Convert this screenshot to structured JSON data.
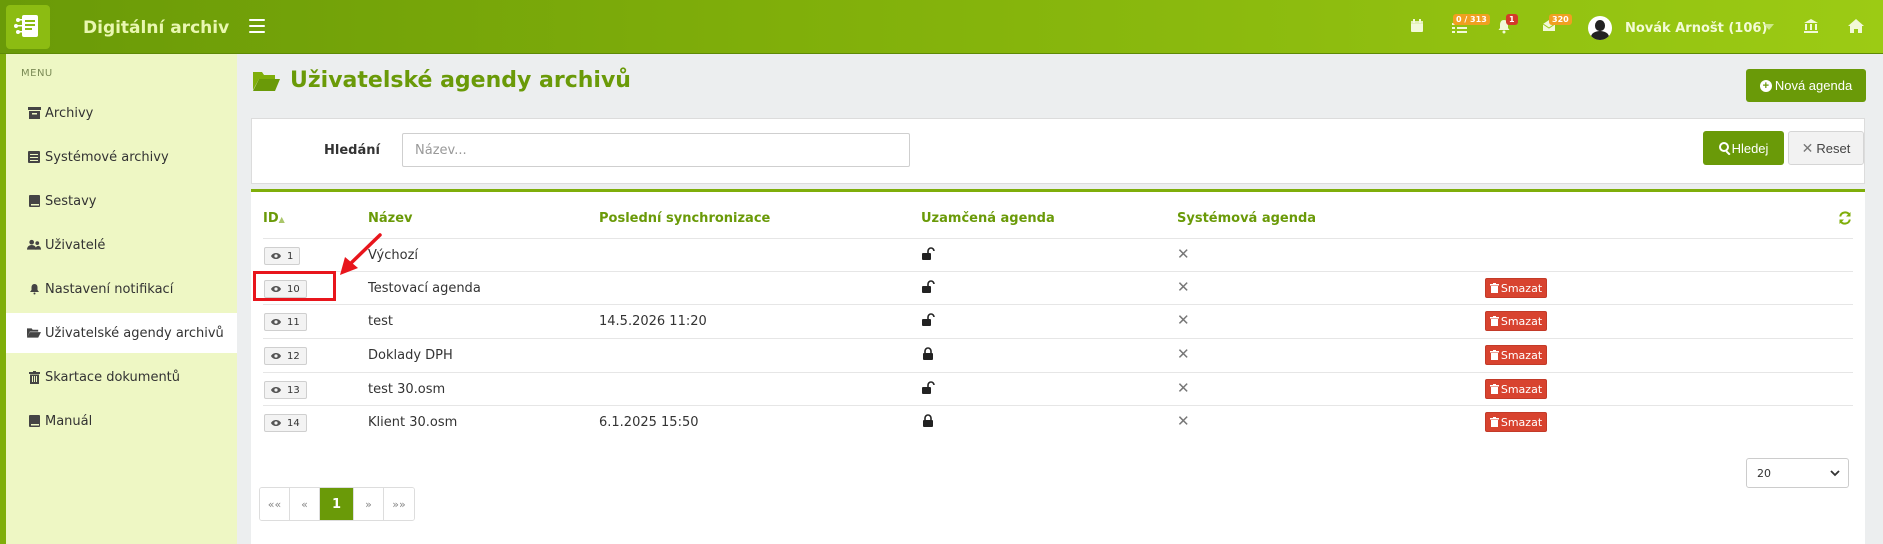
{
  "app": {
    "title": "Digitální archiv"
  },
  "header": {
    "badges": {
      "tasks": "0 / 313",
      "notifications": "1",
      "messages": "320"
    },
    "user_name": "Novák Arnošt (106)"
  },
  "sidebar": {
    "menu_label": "MENU",
    "items": [
      {
        "label": "Archivy",
        "icon": "archive-icon"
      },
      {
        "label": "Systémové archivy",
        "icon": "database-icon"
      },
      {
        "label": "Sestavy",
        "icon": "book-icon"
      },
      {
        "label": "Uživatelé",
        "icon": "users-icon"
      },
      {
        "label": "Nastavení notifikací",
        "icon": "bell-icon"
      },
      {
        "label": "Uživatelské agendy archivů",
        "icon": "folder-open-icon",
        "active": true
      },
      {
        "label": "Skartace dokumentů",
        "icon": "trash-icon"
      },
      {
        "label": "Manuál",
        "icon": "book-icon"
      }
    ]
  },
  "page": {
    "title": "Uživatelské agendy archivů",
    "new_button": "Nová agenda"
  },
  "search": {
    "label": "Hledání",
    "placeholder": "Název...",
    "search_button": "Hledej",
    "reset_button": "Reset"
  },
  "table": {
    "headers": {
      "id": "ID",
      "name": "Název",
      "last_sync": "Poslední synchronizace",
      "locked": "Uzamčená agenda",
      "system": "Systémová agenda"
    },
    "delete_label": "Smazat",
    "rows": [
      {
        "id": "1",
        "name": "Výchozí",
        "last_sync": "",
        "locked": false,
        "system": false,
        "deletable": false
      },
      {
        "id": "10",
        "name": "Testovací agenda",
        "last_sync": "",
        "locked": false,
        "system": false,
        "deletable": true
      },
      {
        "id": "11",
        "name": "test",
        "last_sync": "14.5.2026 11:20",
        "locked": false,
        "system": false,
        "deletable": true
      },
      {
        "id": "12",
        "name": "Doklady DPH",
        "last_sync": "",
        "locked": true,
        "system": false,
        "deletable": true
      },
      {
        "id": "13",
        "name": "test 30.osm",
        "last_sync": "",
        "locked": false,
        "system": false,
        "deletable": true
      },
      {
        "id": "14",
        "name": "Klient 30.osm",
        "last_sync": "6.1.2025 15:50",
        "locked": true,
        "system": false,
        "deletable": true
      }
    ]
  },
  "pagination": {
    "first": "««",
    "prev": "«",
    "current": "1",
    "next": "»",
    "last": "»»",
    "per_page": "20"
  },
  "colors": {
    "brand": "#7fae0a",
    "brand_dark": "#6a9a08",
    "danger": "#d8432f",
    "highlight": "#e8151c"
  }
}
